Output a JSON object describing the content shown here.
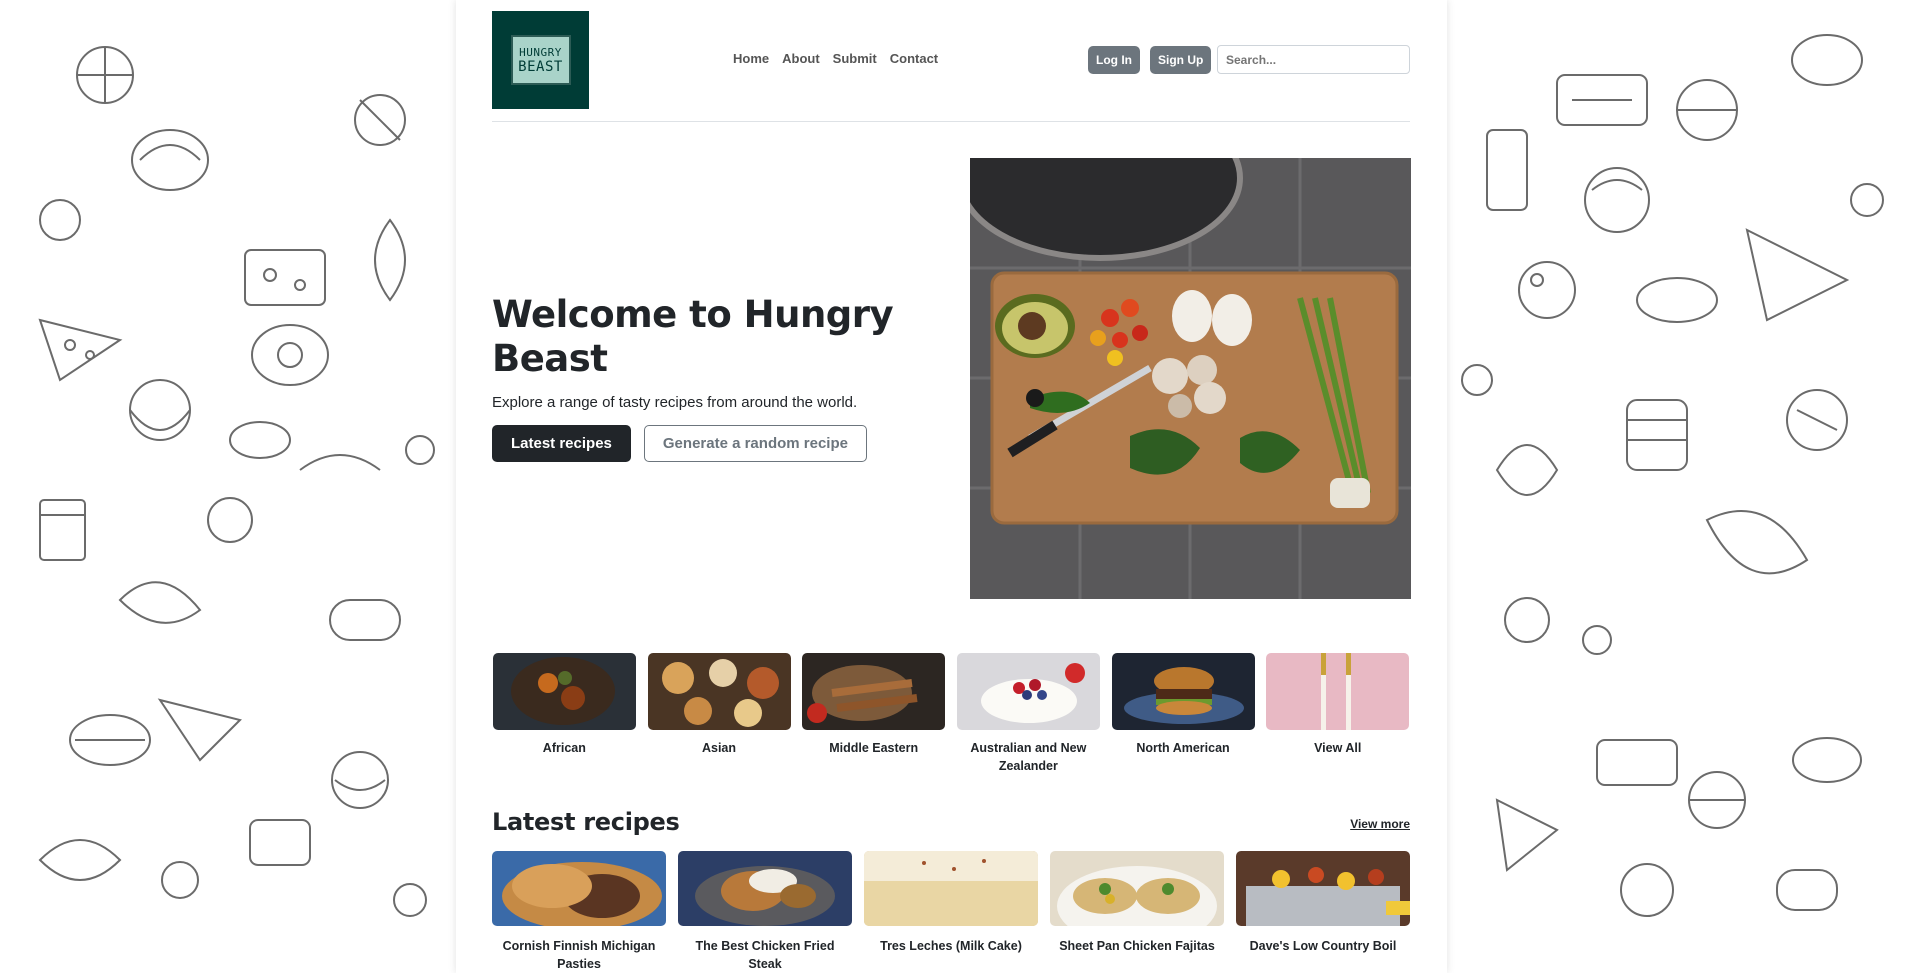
{
  "brand": {
    "logo_line1": "HUNGRY",
    "logo_line2": "BEAST",
    "color_primary": "#003c36",
    "color_logo_inner": "#a9d3c9"
  },
  "nav": {
    "items": [
      {
        "label": "Home"
      },
      {
        "label": "About"
      },
      {
        "label": "Submit"
      },
      {
        "label": "Contact"
      }
    ]
  },
  "auth": {
    "login_label": "Log In",
    "signup_label": "Sign Up"
  },
  "search": {
    "placeholder": "Search..."
  },
  "hero": {
    "title": "Welcome to Hungry Beast",
    "subtitle": "Explore a range of tasty recipes from around the world.",
    "primary_button": "Latest recipes",
    "secondary_button": "Generate a random recipe"
  },
  "categories": [
    {
      "label": "African"
    },
    {
      "label": "Asian"
    },
    {
      "label": "Middle Eastern"
    },
    {
      "label": "Australian and New Zealander"
    },
    {
      "label": "North American"
    },
    {
      "label": "View All"
    }
  ],
  "latest": {
    "heading": "Latest recipes",
    "view_more": "View more",
    "recipes": [
      {
        "title": "Cornish Finnish Michigan Pasties"
      },
      {
        "title": "The Best Chicken Fried Steak"
      },
      {
        "title": "Tres Leches (Milk Cake)"
      },
      {
        "title": "Sheet Pan Chicken Fajitas"
      },
      {
        "title": "Dave's Low Country Boil"
      }
    ]
  }
}
